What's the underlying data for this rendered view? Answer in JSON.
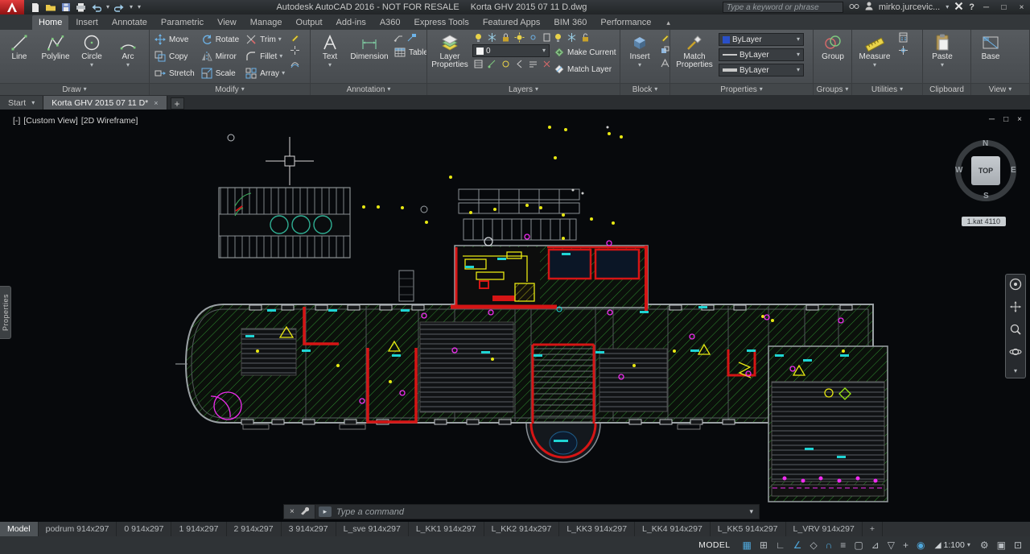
{
  "glyphs": {
    "down_arrow": "▾",
    "close": "×",
    "minimize": "─",
    "restore": "□",
    "help": "?",
    "prompt": "▸",
    "plus": "+",
    "ribbon_toggle": "▴"
  },
  "titlebar": {
    "app_title": "Autodesk AutoCAD 2016 - NOT FOR RESALE",
    "doc_title": "Korta GHV 2015 07 11 D.dwg",
    "search_placeholder": "Type a keyword or phrase",
    "user_name": "mirko.jurcevic..."
  },
  "ribbon": {
    "tabs": [
      "Home",
      "Insert",
      "Annotate",
      "Parametric",
      "View",
      "Manage",
      "Output",
      "Add-ins",
      "A360",
      "Express Tools",
      "Featured Apps",
      "BIM 360",
      "Performance"
    ],
    "draw": {
      "title": "Draw",
      "line": "Line",
      "polyline": "Polyline",
      "circle": "Circle",
      "arc": "Arc"
    },
    "modify": {
      "title": "Modify",
      "move": "Move",
      "copy": "Copy",
      "stretch": "Stretch",
      "rotate": "Rotate",
      "mirror": "Mirror",
      "scale": "Scale",
      "trim": "Trim",
      "fillet": "Fillet",
      "array": "Array"
    },
    "annotation": {
      "title": "Annotation",
      "text": "Text",
      "dimension": "Dimension",
      "table": "Table"
    },
    "layers": {
      "title": "Layers",
      "layer_properties": "Layer Properties",
      "current_layer": "0",
      "make_current": "Make Current",
      "match_layer": "Match Layer"
    },
    "block": {
      "title": "Block",
      "insert": "Insert"
    },
    "properties": {
      "title": "Properties",
      "match_properties": "Match Properties",
      "color": "ByLayer",
      "linetype": "ByLayer",
      "lineweight": "ByLayer"
    },
    "groups": {
      "title": "Groups",
      "group": "Group"
    },
    "utilities": {
      "title": "Utilities",
      "measure": "Measure"
    },
    "clipboard": {
      "title": "Clipboard",
      "paste": "Paste"
    },
    "view_panel": {
      "title": "View",
      "base": "Base"
    }
  },
  "file_tabs": {
    "start": "Start",
    "active_doc": "Korta GHV 2015 07 11 D*"
  },
  "viewport": {
    "view_controls": {
      "pane": "[-]",
      "view": "[Custom View]",
      "style": "[2D Wireframe]"
    },
    "viewcube": {
      "top": "TOP",
      "north": "N",
      "south": "S",
      "east": "E",
      "west": "W"
    },
    "level_tag": "1.kat 4110",
    "properties_tab": "Properties"
  },
  "command": {
    "placeholder": "Type a command"
  },
  "layout": {
    "tabs": [
      "Model",
      "podrum 914x297",
      "0 914x297",
      "1 914x297",
      "2 914x297",
      "3 914x297",
      "L_sve 914x297",
      "L_KK1 914x297",
      "L_KK2 914x297",
      "L_KK3 914x297",
      "L_KK4 914x297",
      "L_KK5 914x297",
      "L_VRV 914x297"
    ]
  },
  "status": {
    "model_label": "MODEL",
    "scale": "1:100",
    "scale_icon": "◢",
    "icons": [
      "▦",
      "⊞",
      "∟",
      "∠",
      "◇",
      "∩",
      "≡",
      "▢",
      "⊿",
      "▽",
      "+",
      "◉",
      "⚙",
      "▣",
      "⊡"
    ]
  }
}
